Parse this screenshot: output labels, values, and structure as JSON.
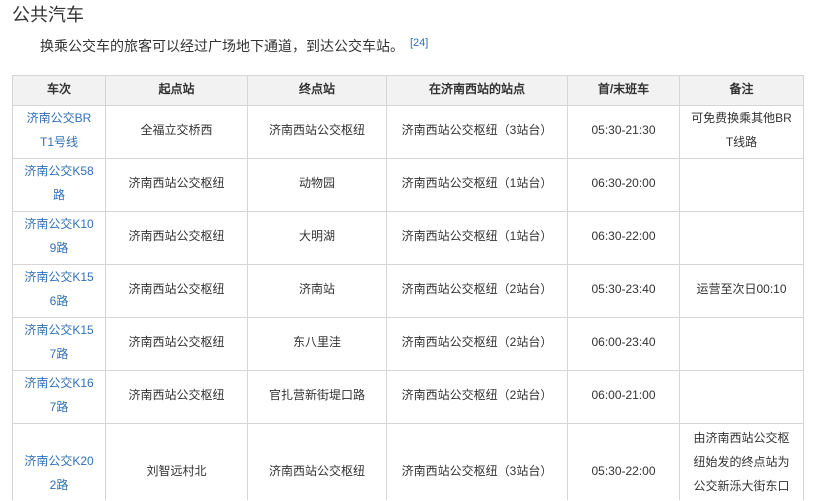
{
  "colors": {
    "link": "#2f6fb6",
    "text": "#333333",
    "border": "#d6d6d6",
    "header_background": "#f2f2f2"
  },
  "section": {
    "heading": "公共汽车",
    "intro": "换乘公交车的旅客可以经过广场地下通道，到达公交车站。",
    "reference": "[24]"
  },
  "table": {
    "columns": [
      "车次",
      "起点站",
      "终点站",
      "在济南西站的站点",
      "首/末班车",
      "备注"
    ],
    "rows": [
      {
        "route": "济南公交BRT1号线",
        "start": "全福立交桥西",
        "end": "济南西站公交枢纽",
        "stop": "济南西站公交枢纽（3站台）",
        "hours": "05:30-21:30",
        "note": "可免费换乘其他BRT线路"
      },
      {
        "route": "济南公交K58路",
        "start": "济南西站公交枢纽",
        "end": "动物园",
        "stop": "济南西站公交枢纽（1站台）",
        "hours": "06:30-20:00"
      },
      {
        "route": "济南公交K109路",
        "start": "济南西站公交枢纽",
        "end": "大明湖",
        "stop": "济南西站公交枢纽（1站台）",
        "hours": "06:30-22:00"
      },
      {
        "route": "济南公交K156路",
        "start": "济南西站公交枢纽",
        "end": "济南站",
        "stop": "济南西站公交枢纽（2站台）",
        "hours": "05:30-23:40",
        "note": "运营至次日00:10"
      },
      {
        "route": "济南公交K157路",
        "start": "济南西站公交枢纽",
        "end": "东八里洼",
        "stop": "济南西站公交枢纽（2站台）",
        "hours": "06:00-23:40"
      },
      {
        "route": "济南公交K167路",
        "start": "济南西站公交枢纽",
        "end": "官扎营新街堤口路",
        "stop": "济南西站公交枢纽（2站台）",
        "hours": "06:00-21:00"
      },
      {
        "route": "济南公交K202路",
        "start": "刘智远村北",
        "end": "济南西站公交枢纽",
        "stop": "济南西站公交枢纽（3站台）",
        "hours": "05:30-22:00",
        "note": "由济南西站公交枢纽始发的终点站为公交新泺大街东口"
      }
    ]
  }
}
